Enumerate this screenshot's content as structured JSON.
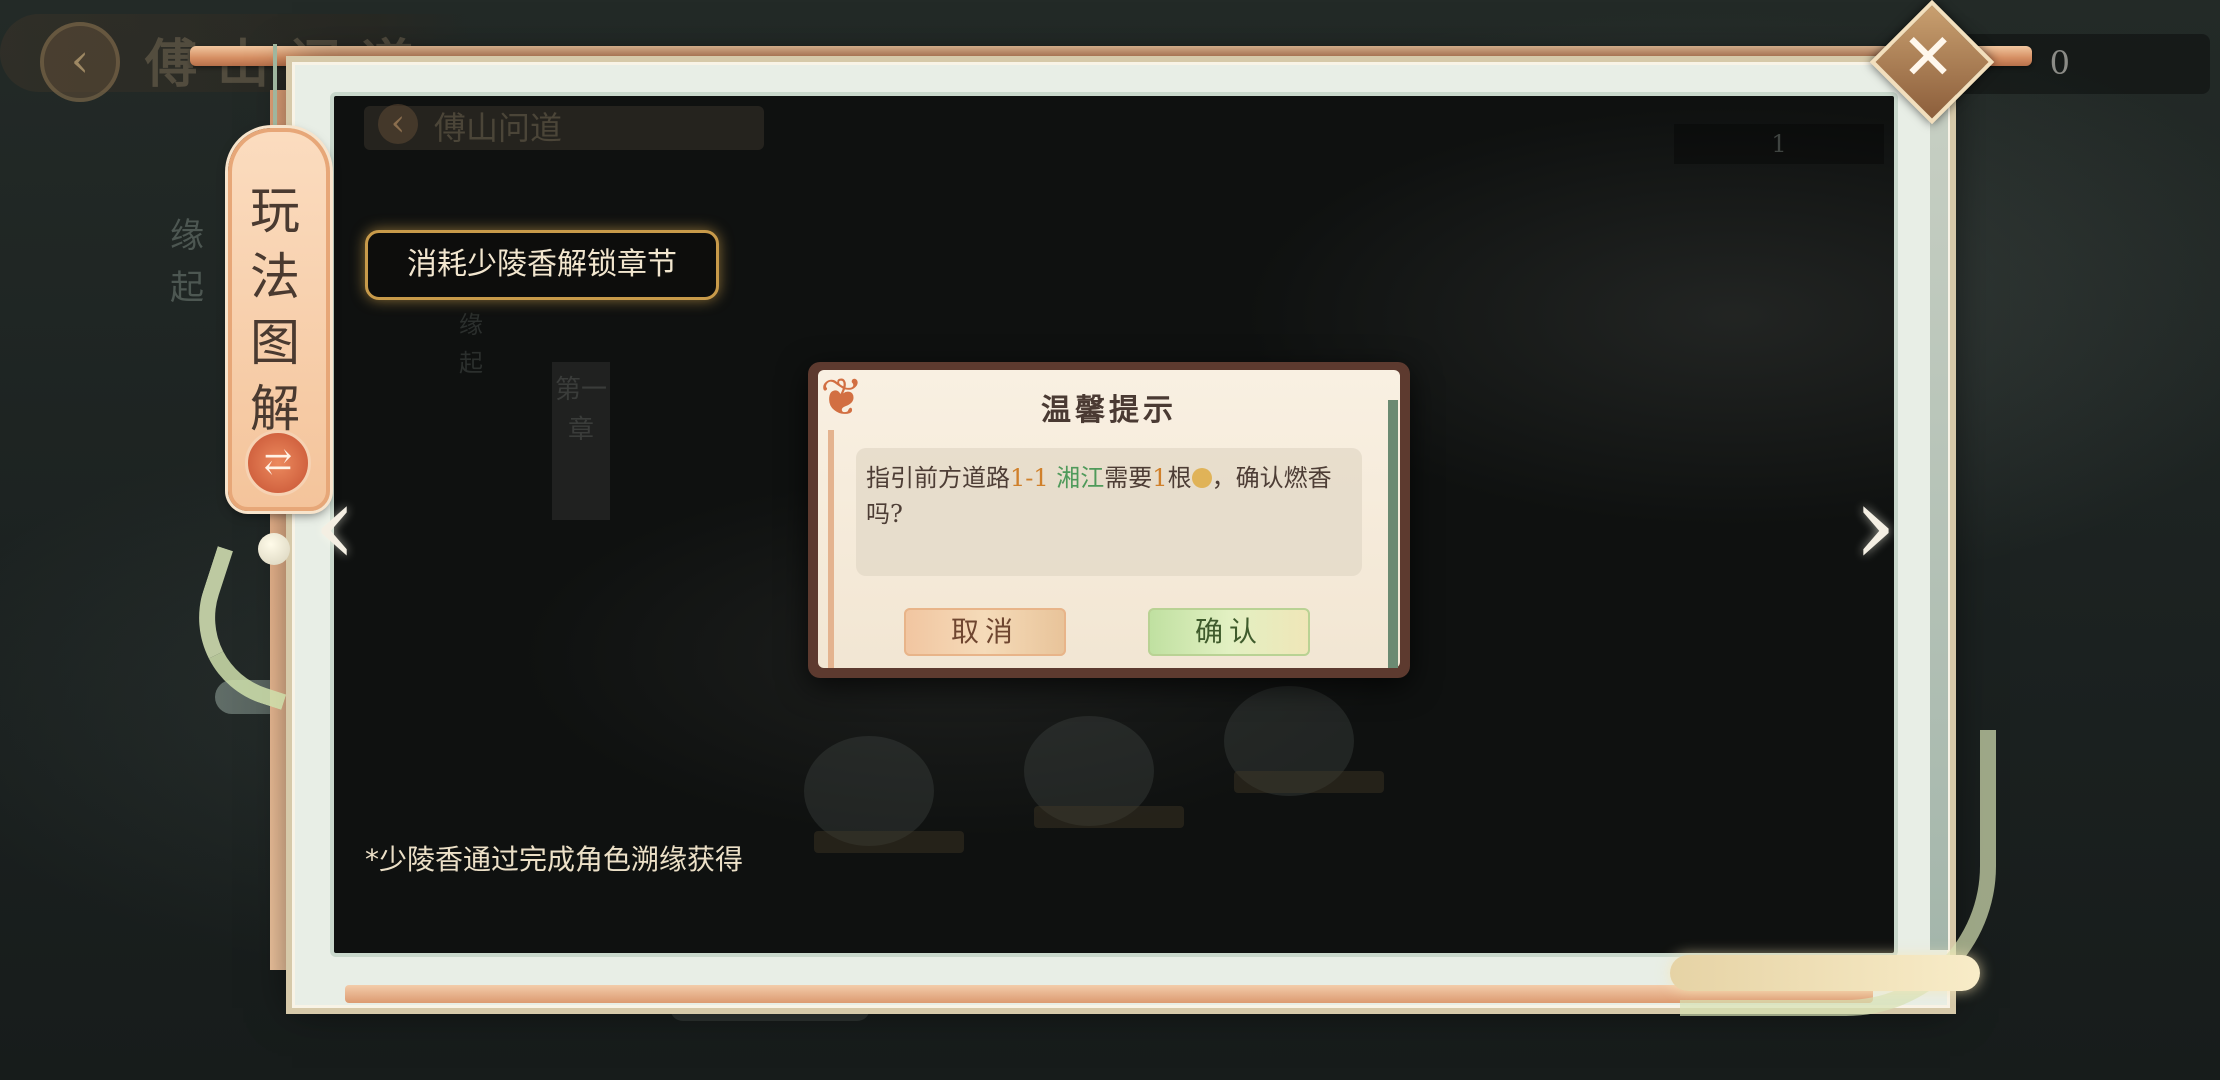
{
  "background": {
    "title": "傅山问道",
    "counter_value": "0",
    "side_label": "缘起"
  },
  "inner_preview": {
    "title": "傅山问道",
    "counter_value": "1",
    "chapter_label": "第一章"
  },
  "tag": {
    "label": "玩法图解",
    "switch_icon": "swap-arrows-icon"
  },
  "hint": {
    "badge_text": "消耗少陵香解锁章节",
    "footnote": "*少陵香通过完成角色溯缘获得"
  },
  "dialog": {
    "title": "温馨提示",
    "message_part1": "指引前方道路",
    "stage": "1-1",
    "place": "湘江",
    "message_part2": "需要",
    "count": "1",
    "message_part3": "根",
    "message_part4": "，确认燃香吗?",
    "cancel_label": "取消",
    "confirm_label": "确认"
  },
  "icons": {
    "close": "close-icon",
    "prev": "chevron-left-icon",
    "next": "chevron-right-icon",
    "incense": "incense-icon",
    "leaf": "maple-leaf-icon"
  },
  "colors": {
    "highlight_number": "#d0802b",
    "highlight_place": "#4f9a5a",
    "badge_border": "#c89a4a"
  }
}
